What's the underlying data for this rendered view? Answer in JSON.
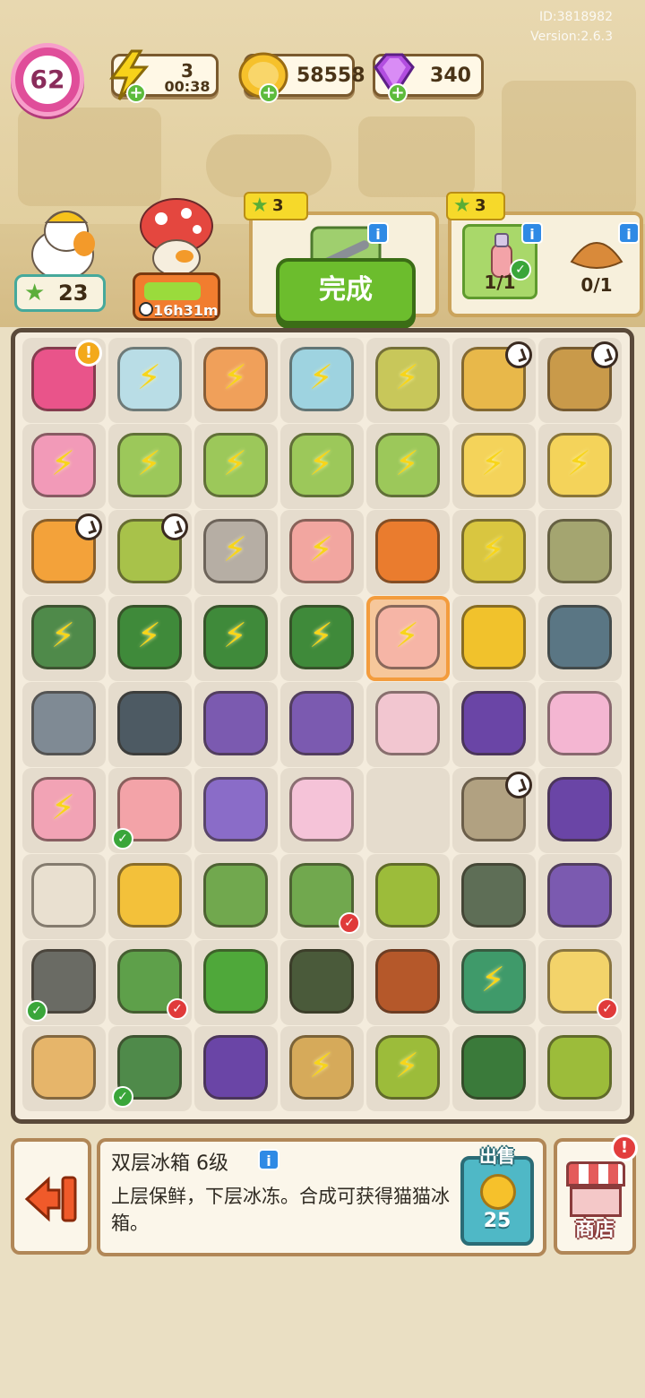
{
  "header": {
    "id_text": "ID:3818982",
    "version_text": "Version:2.6.3",
    "level": "62",
    "energy": {
      "value": "3",
      "timer": "00:38"
    },
    "coins": "58558",
    "gems": "340"
  },
  "characters": {
    "duck_stars": "23",
    "mushroom_timer": "16h31m",
    "mushroom_progress": 0.85
  },
  "orders": {
    "order1": {
      "stars": "3",
      "done_label": "完成"
    },
    "order2": {
      "stars": "3",
      "req1_count": "1/1",
      "req2_count": "0/1"
    }
  },
  "board": {
    "highlighted_cell": [
      3,
      4
    ],
    "cells": [
      [
        {
          "n": "pink-backpack",
          "c": "#e9548a",
          "badge": "alert"
        },
        {
          "n": "robot-vacuum",
          "c": "#b9dde6",
          "bolt": true
        },
        {
          "n": "plasma-lamp",
          "c": "#f0a05a",
          "bolt": true
        },
        {
          "n": "blue-printer",
          "c": "#9ed3e0",
          "bolt": true
        },
        {
          "n": "luggage-cart",
          "c": "#c8c75a",
          "bolt": true
        },
        {
          "n": "potted-sprout",
          "c": "#e8b84a",
          "badge": "clock"
        },
        {
          "n": "wooden-drawers",
          "c": "#c99a4a",
          "badge": "clock"
        }
      ],
      [
        {
          "n": "pink-swim-ring",
          "c": "#f29ab8",
          "bolt": true
        },
        {
          "n": "green-laptop",
          "c": "#9cc85a",
          "bolt": true
        },
        {
          "n": "green-laptop",
          "c": "#9cc85a",
          "bolt": true
        },
        {
          "n": "green-laptop",
          "c": "#9cc85a",
          "bolt": true
        },
        {
          "n": "green-laptop",
          "c": "#9cc85a",
          "bolt": true
        },
        {
          "n": "chick-shopping-cart",
          "c": "#f4d35a",
          "bolt": true
        },
        {
          "n": "chick-shopping-cart",
          "c": "#f4d35a",
          "bolt": true
        }
      ],
      [
        {
          "n": "flower-basket",
          "c": "#f3a23a",
          "badge": "clock"
        },
        {
          "n": "green-flower-basket",
          "c": "#a8c24a",
          "badge": "clock"
        },
        {
          "n": "stone-statue",
          "c": "#b6aea4",
          "bolt": true
        },
        {
          "n": "pink-fridge-small",
          "c": "#f2a6a0",
          "bolt": true
        },
        {
          "n": "orange-robot-vacuum",
          "c": "#ea7c2e"
        },
        {
          "n": "cleaning-supplies",
          "c": "#d9c640",
          "bolt": true
        },
        {
          "n": "fabric-stack",
          "c": "#a4a570"
        }
      ],
      [
        {
          "n": "green-toolbox",
          "c": "#4f8a4a",
          "bolt": true
        },
        {
          "n": "green-toolbox-open",
          "c": "#3f8a3a",
          "bolt": true
        },
        {
          "n": "green-toolbox-open",
          "c": "#3f8a3a",
          "bolt": true
        },
        {
          "n": "green-toolbox-open",
          "c": "#3f8a3a",
          "bolt": true
        },
        {
          "n": "pink-fridge",
          "c": "#f6b5a6",
          "bolt": true
        },
        {
          "n": "yellow-basket",
          "c": "#f1c22c"
        },
        {
          "n": "gray-clamp",
          "c": "#5a7684"
        }
      ],
      [
        {
          "n": "gray-rake",
          "c": "#7f8a94"
        },
        {
          "n": "treadmill",
          "c": "#4d5a63"
        },
        {
          "n": "purple-bin-items",
          "c": "#7b5ab0"
        },
        {
          "n": "purple-bin-items",
          "c": "#7b5ab0"
        },
        {
          "n": "milk-carton",
          "c": "#f2c6d0"
        },
        {
          "n": "purple-goggles",
          "c": "#6a45a6"
        },
        {
          "n": "flower-vase",
          "c": "#f4b6d2"
        }
      ],
      [
        {
          "n": "pink-double-fridge",
          "c": "#f2a3b5",
          "bolt": true
        },
        {
          "n": "spray-bottle",
          "c": "#f3a3a8",
          "badge": "check"
        },
        {
          "n": "lavender-basket",
          "c": "#8a6cc8"
        },
        {
          "n": "lily-bouquet",
          "c": "#f5c3d8"
        },
        {
          "n": "empty",
          "c": ""
        },
        {
          "n": "wooden-locker",
          "c": "#b1a181",
          "badge": "clock"
        },
        {
          "n": "purple-goggles",
          "c": "#6a45a6"
        }
      ],
      [
        {
          "n": "white-mouse",
          "c": "#e9e0d0"
        },
        {
          "n": "yellow-flowers",
          "c": "#f3c13a"
        },
        {
          "n": "green-gloves",
          "c": "#71a84e"
        },
        {
          "n": "green-gloves",
          "c": "#71a84e",
          "badge": "redcheck"
        },
        {
          "n": "mushroom-seed-bag",
          "c": "#9cbc3a"
        },
        {
          "n": "gloves-cobweb",
          "c": "#5e6e56"
        },
        {
          "n": "purple-bin-items",
          "c": "#7b5ab0"
        }
      ],
      [
        {
          "n": "trash-bag",
          "c": "#6a6b64",
          "badge": "check"
        },
        {
          "n": "green-gloves",
          "c": "#5ea04a",
          "badge": "redcheck"
        },
        {
          "n": "pruning-shears",
          "c": "#4fa83a"
        },
        {
          "n": "mushroom-sack",
          "c": "#4a5a3a"
        },
        {
          "n": "leather-wallet",
          "c": "#b5582a"
        },
        {
          "n": "green-toolbox-small",
          "c": "#3f9a6a",
          "bolt": true
        },
        {
          "n": "cat-calendar",
          "c": "#f3d36a",
          "badge": "redcheck"
        }
      ],
      [
        {
          "n": "hamster",
          "c": "#e6b56a"
        },
        {
          "n": "hacksaw",
          "c": "#4f8a4a",
          "badge": "check"
        },
        {
          "n": "purple-goggles",
          "c": "#6a45a6"
        },
        {
          "n": "cardboard-box",
          "c": "#d6aa5a",
          "bolt": true
        },
        {
          "n": "flower-sack",
          "c": "#9cbc3a",
          "bolt": true
        },
        {
          "n": "green-screwdriver",
          "c": "#3a7a3a"
        },
        {
          "n": "mushroom-seed-bag",
          "c": "#9cbc3a"
        }
      ]
    ]
  },
  "info_panel": {
    "item_name": "双层冰箱 6级",
    "item_desc": "上层保鲜，下层冰冻。合成可获得猫猫冰箱。",
    "sell_label": "出售",
    "sell_price": "25"
  },
  "shop": {
    "label": "商店"
  },
  "colors": {
    "bg": "#eadfc3",
    "board_border": "#5a4a3a",
    "accent_green": "#6cbd2d"
  }
}
